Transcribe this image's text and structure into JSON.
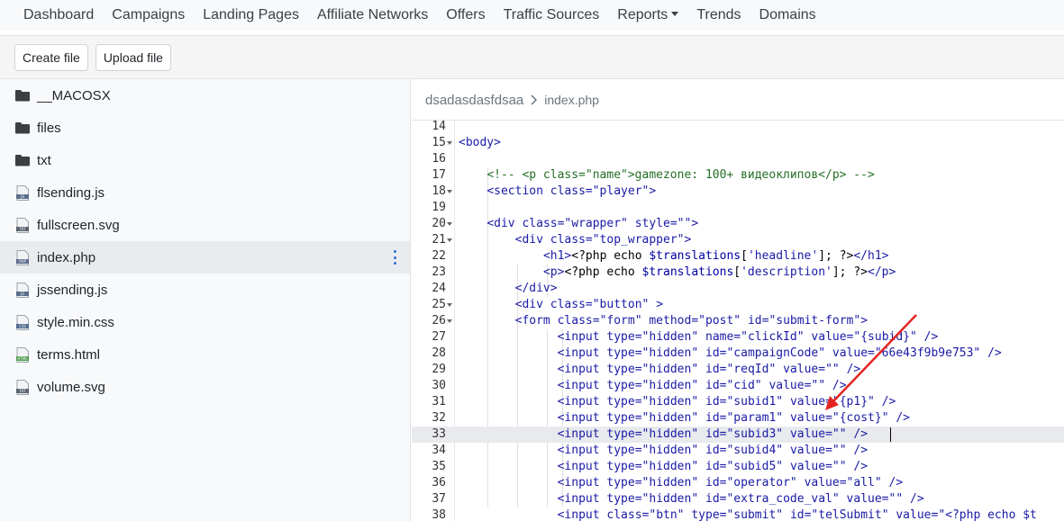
{
  "nav": {
    "items": [
      "Dashboard",
      "Campaigns",
      "Landing Pages",
      "Affiliate Networks",
      "Offers",
      "Traffic Sources",
      "Reports",
      "Trends",
      "Domains"
    ],
    "dropdown_index": 6
  },
  "toolbar": {
    "create_label": "Create file",
    "upload_label": "Upload file"
  },
  "sidebar": {
    "items": [
      {
        "label": "__MACOSX",
        "icon": "folder-icon"
      },
      {
        "label": "files",
        "icon": "folder-icon"
      },
      {
        "label": "txt",
        "icon": "folder-icon"
      },
      {
        "label": "flsending.js",
        "icon": "js-file-icon"
      },
      {
        "label": "fullscreen.svg",
        "icon": "txt-file-icon"
      },
      {
        "label": "index.php",
        "icon": "php-file-icon",
        "active": true
      },
      {
        "label": "jssending.js",
        "icon": "js-file-icon"
      },
      {
        "label": "style.min.css",
        "icon": "css-file-icon"
      },
      {
        "label": "terms.html",
        "icon": "html-file-icon"
      },
      {
        "label": "volume.svg",
        "icon": "txt-file-icon"
      }
    ]
  },
  "breadcrumb": {
    "folder": "dsadasdasfdsaa",
    "file": "index.php"
  },
  "editor": {
    "highlighted_line": 33,
    "lines": [
      {
        "n": "14",
        "fold": false,
        "indent": 0,
        "tokens": []
      },
      {
        "n": "15",
        "fold": true,
        "indent": 0,
        "tokens": [
          [
            "t-tag",
            "<body>"
          ]
        ]
      },
      {
        "n": "16",
        "fold": false,
        "indent": 0,
        "tokens": []
      },
      {
        "n": "17",
        "fold": false,
        "indent": 1,
        "tokens": [
          [
            "t-cmt",
            "<!-- <p class=\"name\">gamezone: 100+ видеоклипов</p> -->"
          ]
        ]
      },
      {
        "n": "18",
        "fold": true,
        "indent": 1,
        "tokens": [
          [
            "t-tag",
            "<section "
          ],
          [
            "t-attr",
            "class="
          ],
          [
            "t-str",
            "\"player\""
          ],
          [
            "t-tag",
            ">"
          ]
        ]
      },
      {
        "n": "19",
        "fold": false,
        "indent": 1,
        "tokens": []
      },
      {
        "n": "20",
        "fold": true,
        "indent": 1,
        "tokens": [
          [
            "t-tag",
            "<div "
          ],
          [
            "t-attr",
            "class="
          ],
          [
            "t-str",
            "\"wrapper\" "
          ],
          [
            "t-attr",
            "style="
          ],
          [
            "t-str",
            "\"\""
          ],
          [
            "t-tag",
            ">"
          ]
        ]
      },
      {
        "n": "21",
        "fold": true,
        "indent": 2,
        "tokens": [
          [
            "t-tag",
            "<div "
          ],
          [
            "t-attr",
            "class="
          ],
          [
            "t-str",
            "\"top_wrapper\""
          ],
          [
            "t-tag",
            ">"
          ]
        ]
      },
      {
        "n": "22",
        "fold": false,
        "indent": 3,
        "tokens": [
          [
            "t-tag",
            "<h1>"
          ],
          [
            "t-php",
            "<?php echo "
          ],
          [
            "t-var",
            "$translations"
          ],
          [
            "t-php",
            "["
          ],
          [
            "t-sq",
            "'headline'"
          ],
          [
            "t-php",
            "]; ?>"
          ],
          [
            "t-tag",
            "</h1>"
          ]
        ]
      },
      {
        "n": "23",
        "fold": false,
        "indent": 3,
        "tokens": [
          [
            "t-tag",
            "<p>"
          ],
          [
            "t-php",
            "<?php echo "
          ],
          [
            "t-var",
            "$translations"
          ],
          [
            "t-php",
            "["
          ],
          [
            "t-sq",
            "'description'"
          ],
          [
            "t-php",
            "]; ?>"
          ],
          [
            "t-tag",
            "</p>"
          ]
        ]
      },
      {
        "n": "24",
        "fold": false,
        "indent": 2,
        "tokens": [
          [
            "t-tag",
            "</div>"
          ]
        ]
      },
      {
        "n": "25",
        "fold": true,
        "indent": 2,
        "tokens": [
          [
            "t-tag",
            "<div "
          ],
          [
            "t-attr",
            "class="
          ],
          [
            "t-str",
            "\"button\" "
          ],
          [
            "t-tag",
            ">"
          ]
        ]
      },
      {
        "n": "26",
        "fold": true,
        "indent": 2,
        "tokens": [
          [
            "t-tag",
            "<form "
          ],
          [
            "t-attr",
            "class="
          ],
          [
            "t-str",
            "\"form\" "
          ],
          [
            "t-attr",
            "method="
          ],
          [
            "t-str",
            "\"post\" "
          ],
          [
            "t-attr",
            "id="
          ],
          [
            "t-str",
            "\"submit-form\""
          ],
          [
            "t-tag",
            ">"
          ]
        ]
      },
      {
        "n": "27",
        "fold": false,
        "indent": 3.5,
        "tokens": [
          [
            "t-tag",
            "<input "
          ],
          [
            "t-attr",
            "type="
          ],
          [
            "t-str",
            "\"hidden\" "
          ],
          [
            "t-attr",
            "name="
          ],
          [
            "t-str",
            "\"clickId\" "
          ],
          [
            "t-attr",
            "value="
          ],
          [
            "t-str",
            "\"{subid}\" "
          ],
          [
            "t-tag",
            "/>"
          ]
        ]
      },
      {
        "n": "28",
        "fold": false,
        "indent": 3.5,
        "tokens": [
          [
            "t-tag",
            "<input "
          ],
          [
            "t-attr",
            "type="
          ],
          [
            "t-str",
            "\"hidden\" "
          ],
          [
            "t-attr",
            "id="
          ],
          [
            "t-str",
            "\"campaignCode\" "
          ],
          [
            "t-attr",
            "value="
          ],
          [
            "t-str",
            "\"66e43f9b9e753\" "
          ],
          [
            "t-tag",
            "/>"
          ]
        ]
      },
      {
        "n": "29",
        "fold": false,
        "indent": 3.5,
        "tokens": [
          [
            "t-tag",
            "<input "
          ],
          [
            "t-attr",
            "type="
          ],
          [
            "t-str",
            "\"hidden\" "
          ],
          [
            "t-attr",
            "id="
          ],
          [
            "t-str",
            "\"reqId\" "
          ],
          [
            "t-attr",
            "value="
          ],
          [
            "t-str",
            "\"\" "
          ],
          [
            "t-tag",
            "/>"
          ]
        ]
      },
      {
        "n": "30",
        "fold": false,
        "indent": 3.5,
        "tokens": [
          [
            "t-tag",
            "<input "
          ],
          [
            "t-attr",
            "type="
          ],
          [
            "t-str",
            "\"hidden\" "
          ],
          [
            "t-attr",
            "id="
          ],
          [
            "t-str",
            "\"cid\" "
          ],
          [
            "t-attr",
            "value="
          ],
          [
            "t-str",
            "\"\" "
          ],
          [
            "t-tag",
            "/>"
          ]
        ]
      },
      {
        "n": "31",
        "fold": false,
        "indent": 3.5,
        "tokens": [
          [
            "t-tag",
            "<input "
          ],
          [
            "t-attr",
            "type="
          ],
          [
            "t-str",
            "\"hidden\" "
          ],
          [
            "t-attr",
            "id="
          ],
          [
            "t-str",
            "\"subid1\" "
          ],
          [
            "t-attr",
            "value="
          ],
          [
            "t-str",
            "\"{p1}\" "
          ],
          [
            "t-tag",
            "/>"
          ]
        ]
      },
      {
        "n": "32",
        "fold": false,
        "indent": 3.5,
        "tokens": [
          [
            "t-tag",
            "<input "
          ],
          [
            "t-attr",
            "type="
          ],
          [
            "t-str",
            "\"hidden\" "
          ],
          [
            "t-attr",
            "id="
          ],
          [
            "t-str",
            "\"param1\" "
          ],
          [
            "t-attr",
            "value="
          ],
          [
            "t-str",
            "\"{cost}\" "
          ],
          [
            "t-tag",
            "/>"
          ]
        ]
      },
      {
        "n": "33",
        "fold": false,
        "indent": 3.5,
        "tokens": [
          [
            "t-tag",
            "<input "
          ],
          [
            "t-attr",
            "type="
          ],
          [
            "t-str",
            "\"hidden\" "
          ],
          [
            "t-attr",
            "id="
          ],
          [
            "t-str",
            "\"subid3\" "
          ],
          [
            "t-attr",
            "value="
          ],
          [
            "t-str",
            "\"\" "
          ],
          [
            "t-tag",
            "/>"
          ]
        ]
      },
      {
        "n": "34",
        "fold": false,
        "indent": 3.5,
        "tokens": [
          [
            "t-tag",
            "<input "
          ],
          [
            "t-attr",
            "type="
          ],
          [
            "t-str",
            "\"hidden\" "
          ],
          [
            "t-attr",
            "id="
          ],
          [
            "t-str",
            "\"subid4\" "
          ],
          [
            "t-attr",
            "value="
          ],
          [
            "t-str",
            "\"\" "
          ],
          [
            "t-tag",
            "/>"
          ]
        ]
      },
      {
        "n": "35",
        "fold": false,
        "indent": 3.5,
        "tokens": [
          [
            "t-tag",
            "<input "
          ],
          [
            "t-attr",
            "type="
          ],
          [
            "t-str",
            "\"hidden\" "
          ],
          [
            "t-attr",
            "id="
          ],
          [
            "t-str",
            "\"subid5\" "
          ],
          [
            "t-attr",
            "value="
          ],
          [
            "t-str",
            "\"\" "
          ],
          [
            "t-tag",
            "/>"
          ]
        ]
      },
      {
        "n": "36",
        "fold": false,
        "indent": 3.5,
        "tokens": [
          [
            "t-tag",
            "<input "
          ],
          [
            "t-attr",
            "type="
          ],
          [
            "t-str",
            "\"hidden\" "
          ],
          [
            "t-attr",
            "id="
          ],
          [
            "t-str",
            "\"operator\" "
          ],
          [
            "t-attr",
            "value="
          ],
          [
            "t-str",
            "\"all\" "
          ],
          [
            "t-tag",
            "/>"
          ]
        ]
      },
      {
        "n": "37",
        "fold": false,
        "indent": 3.5,
        "tokens": [
          [
            "t-tag",
            "<input "
          ],
          [
            "t-attr",
            "type="
          ],
          [
            "t-str",
            "\"hidden\" "
          ],
          [
            "t-attr",
            "id="
          ],
          [
            "t-str",
            "\"extra_code_val\" "
          ],
          [
            "t-attr",
            "value="
          ],
          [
            "t-str",
            "\"\" "
          ],
          [
            "t-tag",
            "/>"
          ]
        ]
      },
      {
        "n": "38",
        "fold": false,
        "indent": 3.5,
        "tokens": [
          [
            "t-tag",
            "<input "
          ],
          [
            "t-attr",
            "class="
          ],
          [
            "t-str",
            "\"btn\" "
          ],
          [
            "t-attr",
            "type="
          ],
          [
            "t-str",
            "\"submit\" "
          ],
          [
            "t-attr",
            "id="
          ],
          [
            "t-str",
            "\"telSubmit\" "
          ],
          [
            "t-attr",
            "value="
          ],
          [
            "t-str",
            "\"<?php echo $t"
          ]
        ]
      }
    ]
  },
  "colors": {
    "accent": "#2f6fd6",
    "annotation_arrow": "#e52421",
    "tag": "#1a1aa6",
    "comment": "#236e25"
  }
}
